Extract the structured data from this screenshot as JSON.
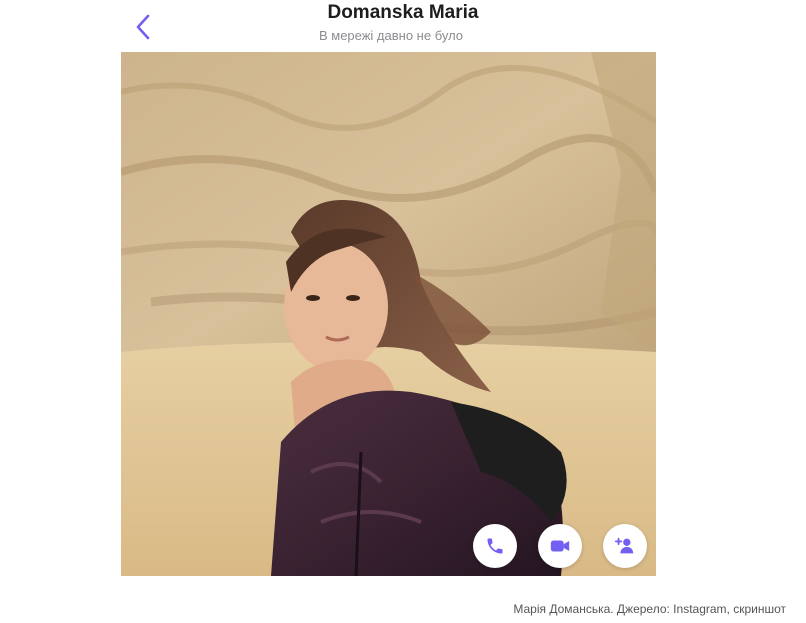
{
  "header": {
    "contact_name": "Domanska Maria",
    "status": "В мережі давно не було",
    "back_icon": "chevron-left-icon"
  },
  "photo": {
    "alt": "profile photo"
  },
  "actions": [
    {
      "icon": "phone-icon"
    },
    {
      "icon": "video-camera-icon"
    },
    {
      "icon": "add-contact-icon"
    }
  ],
  "caption": "Марія Доманська. Джерело: Instagram, скриншот",
  "colors": {
    "accent": "#7360f2",
    "background": "#ffffff",
    "title": "#1d1d1f",
    "subtitle": "#8c8c91"
  }
}
